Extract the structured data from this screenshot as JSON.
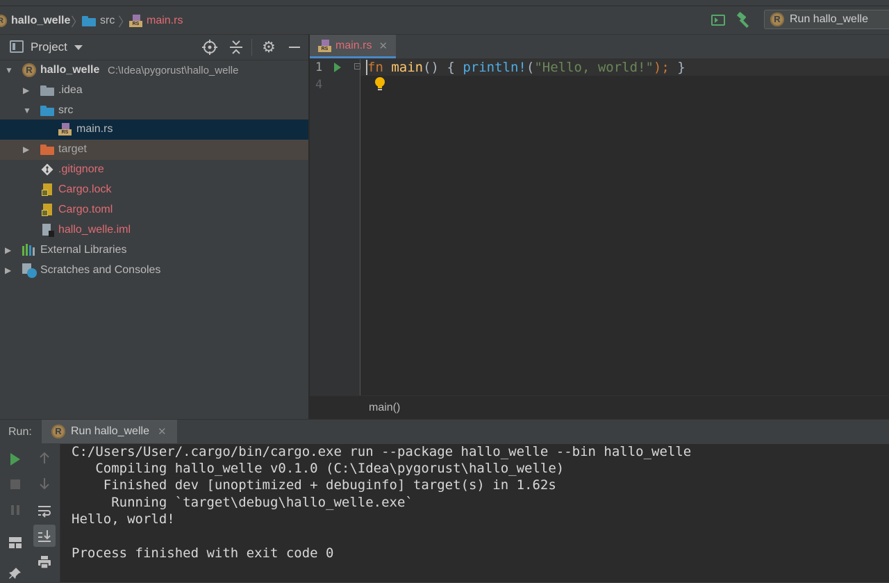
{
  "breadcrumb": {
    "project": "hallo_welle",
    "folder": "src",
    "file": "main.rs"
  },
  "run_config": {
    "label": "Run hallo_welle"
  },
  "project_panel": {
    "title": "Project",
    "root": {
      "name": "hallo_welle",
      "path": "C:\\Idea\\pygorust\\hallo_welle"
    },
    "items": [
      {
        "label": ".idea"
      },
      {
        "label": "src"
      },
      {
        "label": "main.rs"
      },
      {
        "label": "target"
      },
      {
        "label": ".gitignore"
      },
      {
        "label": "Cargo.lock"
      },
      {
        "label": "Cargo.toml"
      },
      {
        "label": "hallo_welle.iml"
      },
      {
        "label": "External Libraries"
      },
      {
        "label": "Scratches and Consoles"
      }
    ]
  },
  "editor": {
    "tab_label": "main.rs",
    "line_numbers": [
      "1",
      "4"
    ],
    "code": {
      "kw": "fn",
      "name": "main",
      "parens": "()",
      "brace_open": "{",
      "macro": "println!",
      "lparen": "(",
      "string": "\"Hello, world!\"",
      "rparen_semi": ");",
      "brace_close": "}"
    },
    "breadcrumb": "main()"
  },
  "run_panel": {
    "label": "Run:",
    "tab_label": "Run hallo_welle",
    "console": [
      "C:/Users/User/.cargo/bin/cargo.exe run --package hallo_welle --bin hallo_welle",
      "   Compiling hallo_welle v0.1.0 (C:\\Idea\\pygorust\\hallo_welle)",
      "    Finished dev [unoptimized + debuginfo] target(s) in 1.62s",
      "     Running `target\\debug\\hallo_welle.exe`",
      "Hello, world!",
      "",
      "Process finished with exit code 0"
    ]
  },
  "colors": {
    "accent": "#4a88c7",
    "run_green": "#499c54",
    "modified_file": "#e06c75"
  }
}
